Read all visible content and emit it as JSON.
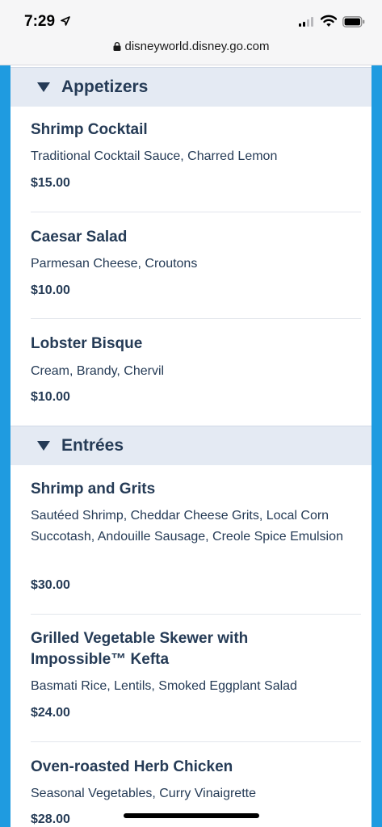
{
  "status": {
    "time": "7:29"
  },
  "browser": {
    "url": "disneyworld.disney.go.com"
  },
  "sections": [
    {
      "title": "Appetizers",
      "items": [
        {
          "name": "Shrimp Cocktail",
          "description": "Traditional Cocktail Sauce, Charred Lemon",
          "price": "$15.00"
        },
        {
          "name": "Caesar Salad",
          "description": "Parmesan Cheese, Croutons",
          "price": "$10.00"
        },
        {
          "name": "Lobster Bisque",
          "description": "Cream, Brandy, Chervil",
          "price": "$10.00"
        }
      ]
    },
    {
      "title": "Entrées",
      "items": [
        {
          "name": "Shrimp and Grits",
          "description": "Sautéed Shrimp, Cheddar Cheese Grits, Local Corn Succotash, Andouille Sausage, Creole Spice Emulsion",
          "price": "$30.00"
        },
        {
          "name": "Grilled Vegetable Skewer with Impossible™ Kefta",
          "description": "Basmati Rice, Lentils, Smoked Eggplant Salad",
          "price": "$24.00"
        },
        {
          "name": "Oven-roasted Herb Chicken",
          "description": "Seasonal Vegetables, Curry Vinaigrette",
          "price": "$28.00"
        }
      ]
    }
  ],
  "colors": {
    "accent": "#1f9be0",
    "text": "#253b56",
    "section_bg": "#e4eaf3"
  }
}
